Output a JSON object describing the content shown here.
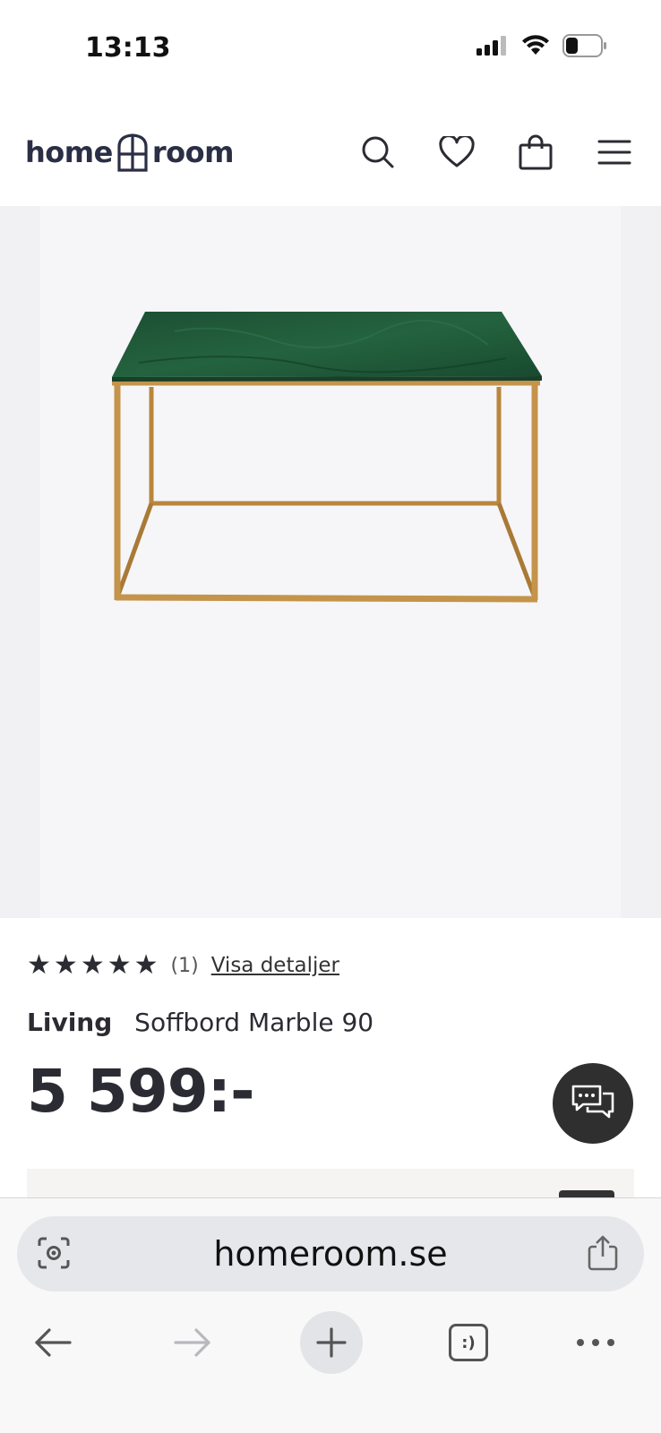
{
  "status_bar": {
    "time": "13:13"
  },
  "header": {
    "logo_left": "home",
    "logo_right": "room",
    "icons": [
      "search-icon",
      "heart-icon",
      "bag-icon",
      "menu-icon"
    ]
  },
  "product": {
    "rating": {
      "stars_filled": 5,
      "stars_total": 5,
      "count": "(1)",
      "details_link": "Visa detaljer"
    },
    "brand": "Living",
    "name": "Soffbord Marble 90",
    "price": "5 599:-",
    "image_subject": "green marble coffee table with brass frame"
  },
  "browser": {
    "url": "homeroom.se",
    "tabs_label": ":)"
  },
  "colors": {
    "text_dark": "#2b2b33",
    "logo_navy": "#2a2f45",
    "image_bg": "#f1f1f3",
    "marble_green": "#1f5a3a",
    "brass": "#c4944b",
    "chat_bg": "#2f2f2f"
  }
}
